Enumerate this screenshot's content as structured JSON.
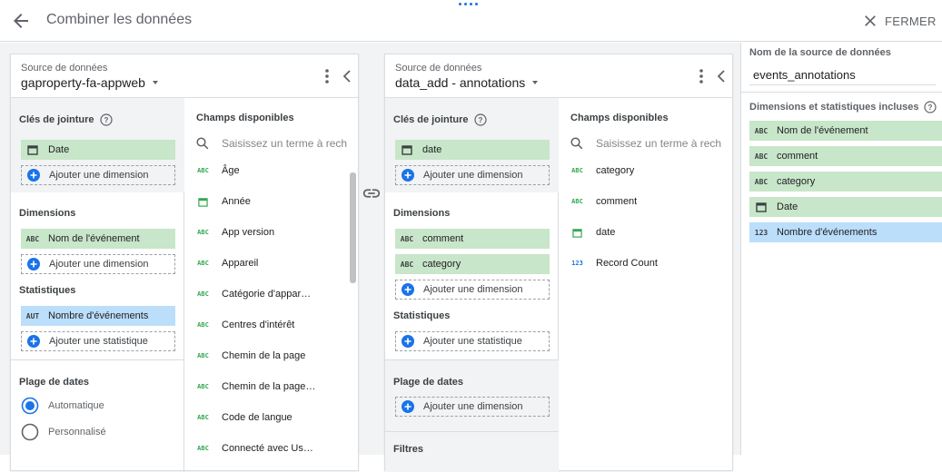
{
  "header": {
    "title": "Combiner les données",
    "close_label": "FERMER"
  },
  "colors": {
    "dimension_chip": "#c8e6c9",
    "metric_chip": "#bbdefb",
    "accent": "#1a73e8"
  },
  "source1": {
    "label": "Source de données",
    "name": "gaproperty-fa-appweb",
    "join_title": "Clés de jointure",
    "join_keys": [
      {
        "icon": "calendar-icon",
        "label": "Date"
      }
    ],
    "add_dimension": "Ajouter une dimension",
    "dimensions_title": "Dimensions",
    "dimensions": [
      {
        "icon": "ABC",
        "label": "Nom de l'événement"
      }
    ],
    "metrics_title": "Statistiques",
    "metrics": [
      {
        "icon": "AUT",
        "label": "Nombre d'événements"
      }
    ],
    "add_metric": "Ajouter une statistique",
    "date_range_title": "Plage de dates",
    "date_options": [
      "Automatique",
      "Personnalisé"
    ],
    "fields_title": "Champs disponibles",
    "search_placeholder": "Saisissez un terme à rech",
    "fields": [
      {
        "type": "ABC",
        "label": "Âge"
      },
      {
        "type": "calendar",
        "label": "Année"
      },
      {
        "type": "ABC",
        "label": "App version"
      },
      {
        "type": "ABC",
        "label": "Appareil"
      },
      {
        "type": "ABC",
        "label": "Catégorie d'appar…"
      },
      {
        "type": "ABC",
        "label": "Centres d'intérêt"
      },
      {
        "type": "ABC",
        "label": "Chemin de la page"
      },
      {
        "type": "ABC",
        "label": "Chemin de la page…"
      },
      {
        "type": "ABC",
        "label": "Code de langue"
      },
      {
        "type": "ABC",
        "label": "Connecté avec Us…"
      }
    ]
  },
  "source2": {
    "label": "Source de données",
    "name": "data_add - annotations",
    "join_title": "Clés de jointure",
    "join_keys": [
      {
        "icon": "calendar-icon",
        "label": "date"
      }
    ],
    "add_dimension": "Ajouter une dimension",
    "dimensions_title": "Dimensions",
    "dimensions": [
      {
        "icon": "ABC",
        "label": "comment"
      },
      {
        "icon": "ABC",
        "label": "category"
      }
    ],
    "metrics_title": "Statistiques",
    "add_metric": "Ajouter une statistique",
    "date_range_title": "Plage de dates",
    "filters_title": "Filtres",
    "fields_title": "Champs disponibles",
    "search_placeholder": "Saisissez un terme à rech",
    "fields": [
      {
        "type": "ABC",
        "label": "category"
      },
      {
        "type": "ABC",
        "label": "comment"
      },
      {
        "type": "calendar",
        "label": "date"
      },
      {
        "type": "123",
        "label": "Record Count"
      }
    ]
  },
  "result": {
    "name_label": "Nom de la source de données",
    "name_value": "events_annotations",
    "included_title": "Dimensions et statistiques incluses",
    "items": [
      {
        "icon": "ABC",
        "label": "Nom de l'événement",
        "kind": "dimension"
      },
      {
        "icon": "ABC",
        "label": "comment",
        "kind": "dimension"
      },
      {
        "icon": "ABC",
        "label": "category",
        "kind": "dimension"
      },
      {
        "icon": "calendar",
        "label": "Date",
        "kind": "dimension"
      },
      {
        "icon": "123",
        "label": "Nombre d'événements",
        "kind": "metric"
      }
    ]
  }
}
